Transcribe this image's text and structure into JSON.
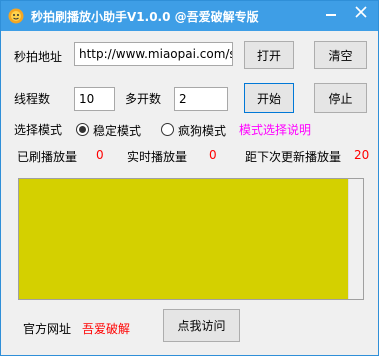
{
  "window": {
    "title": "秒拍刷播放小助手V1.0.0  @吾爱破解专版",
    "minimize_icon": "minimize-icon",
    "close_icon": "close-icon"
  },
  "form": {
    "url_label": "秒拍地址",
    "url_value": "http://www.miaopai.com/sh",
    "open_button": "打开",
    "clear_button": "清空",
    "threads_label": "线程数",
    "threads_value": "10",
    "instances_label": "多开数",
    "instances_value": "2",
    "start_button": "开始",
    "stop_button": "停止",
    "mode_label": "选择模式",
    "mode_stable": "稳定模式",
    "mode_crazy": "疯狗模式",
    "mode_stable_checked": true,
    "mode_help_link": "模式选择说明"
  },
  "stats": {
    "played_label": "已刷播放量",
    "played_value": "0",
    "realtime_label": "实时播放量",
    "realtime_value": "0",
    "next_update_label": "距下次更新播放量",
    "next_update_value": "20"
  },
  "footer": {
    "site_label": "官方网址",
    "site_link": "吾爱破解",
    "visit_button": "点我访问"
  },
  "colors": {
    "titlebar": "#3e9ee6",
    "log_panel": "#d4d000",
    "accent_red": "#ff0000",
    "accent_magenta": "#ff00ff"
  }
}
